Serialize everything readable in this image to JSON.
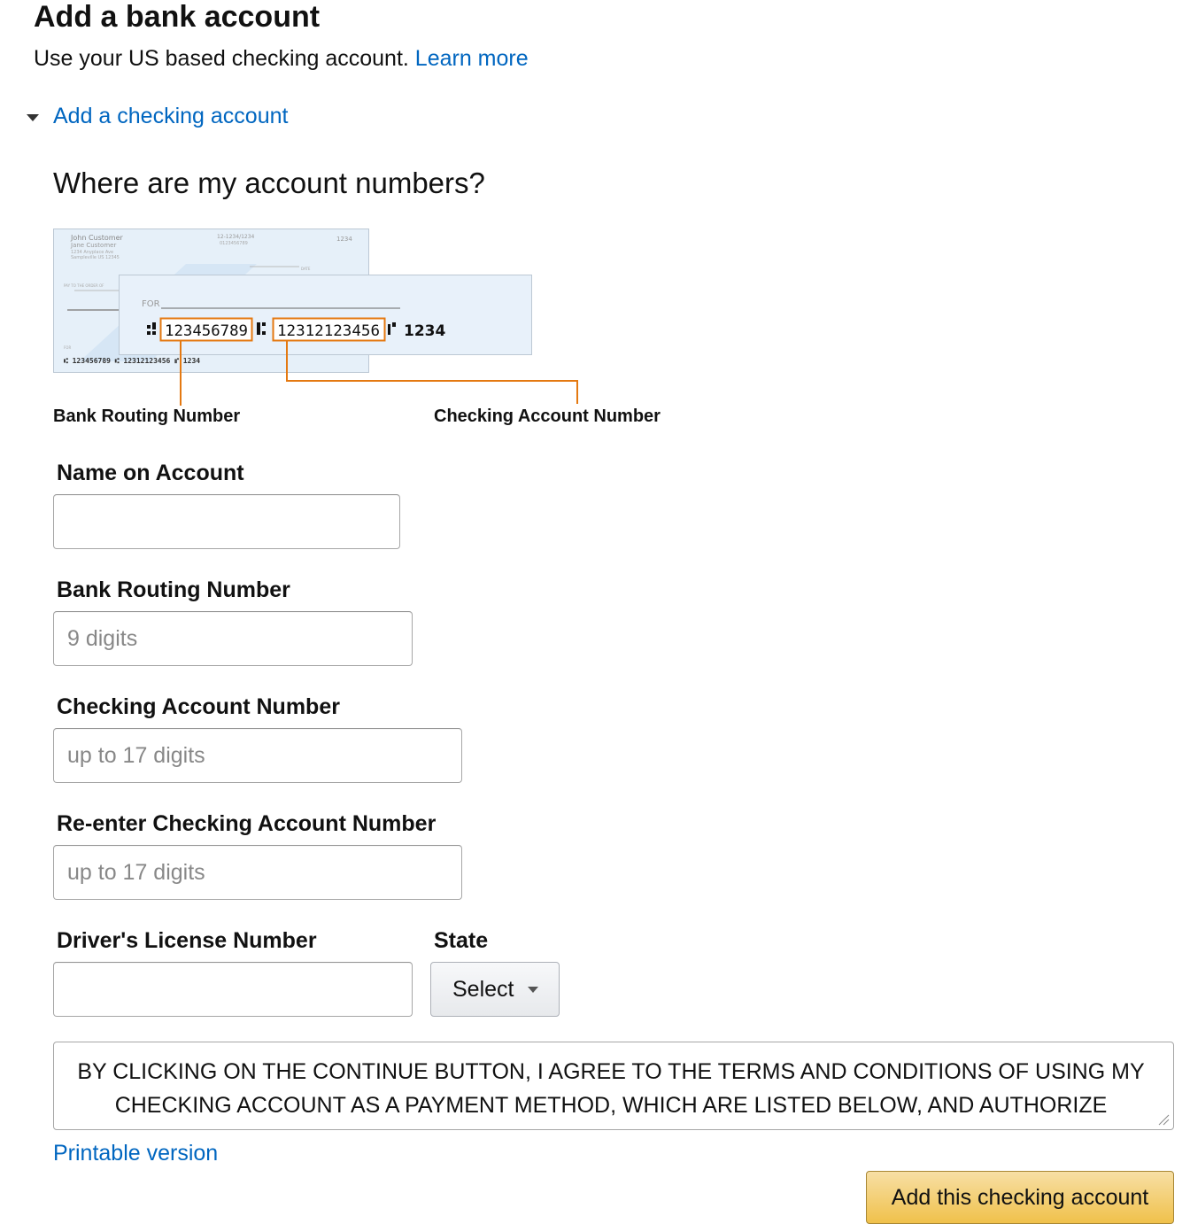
{
  "header": {
    "title": "Add a bank account",
    "subtitle": "Use your US based checking account.",
    "learn_more": "Learn more"
  },
  "expander": {
    "label": "Add a checking account",
    "icon": "triangle-down-icon"
  },
  "help": {
    "heading": "Where are my account numbers?",
    "illustration": {
      "back_name": "John Customer",
      "back_name2": "Jane Customer",
      "back_addr": "1234 Anyplace Ave",
      "back_city": "Sampleville US 12345",
      "back_top_num": "12-1234/1234",
      "back_top_num2": "0123456789",
      "back_check_no": "1234",
      "back_payto": "PAY TO THE ORDER OF",
      "back_date": "DATE",
      "back_for": "FOR",
      "back_micr": "⑆ 123456789 ⑆ 12312123456 ⑈ 1234",
      "for_label": "FOR",
      "routing_number": "123456789",
      "account_number": "12312123456",
      "check_number": "1234"
    },
    "routing_caption": "Bank Routing Number",
    "account_caption": "Checking Account Number"
  },
  "form": {
    "name_label": "Name on Account",
    "name_value": "",
    "routing_label": "Bank Routing Number",
    "routing_placeholder": "9 digits",
    "account_label": "Checking Account Number",
    "account_placeholder": "up to 17 digits",
    "reenter_label": "Re-enter Checking Account Number",
    "reenter_placeholder": "up to 17 digits",
    "license_label": "Driver's License Number",
    "license_value": "",
    "state_label": "State",
    "state_selected": "Select"
  },
  "terms": {
    "text": "BY CLICKING ON THE CONTINUE BUTTON, I AGREE TO THE TERMS AND CONDITIONS OF USING MY CHECKING ACCOUNT AS A PAYMENT METHOD, WHICH ARE LISTED BELOW, AND AUTHORIZE AMAZON.COM TO DEBIT MY CHECKING ACCOUNT FOR PURCHASES MADE ON AMAZON.COM"
  },
  "printable_link": "Printable version",
  "submit_button": "Add this checking account",
  "colors": {
    "link": "#0066c0",
    "button": "#f0c14b",
    "highlight": "#e47911"
  }
}
